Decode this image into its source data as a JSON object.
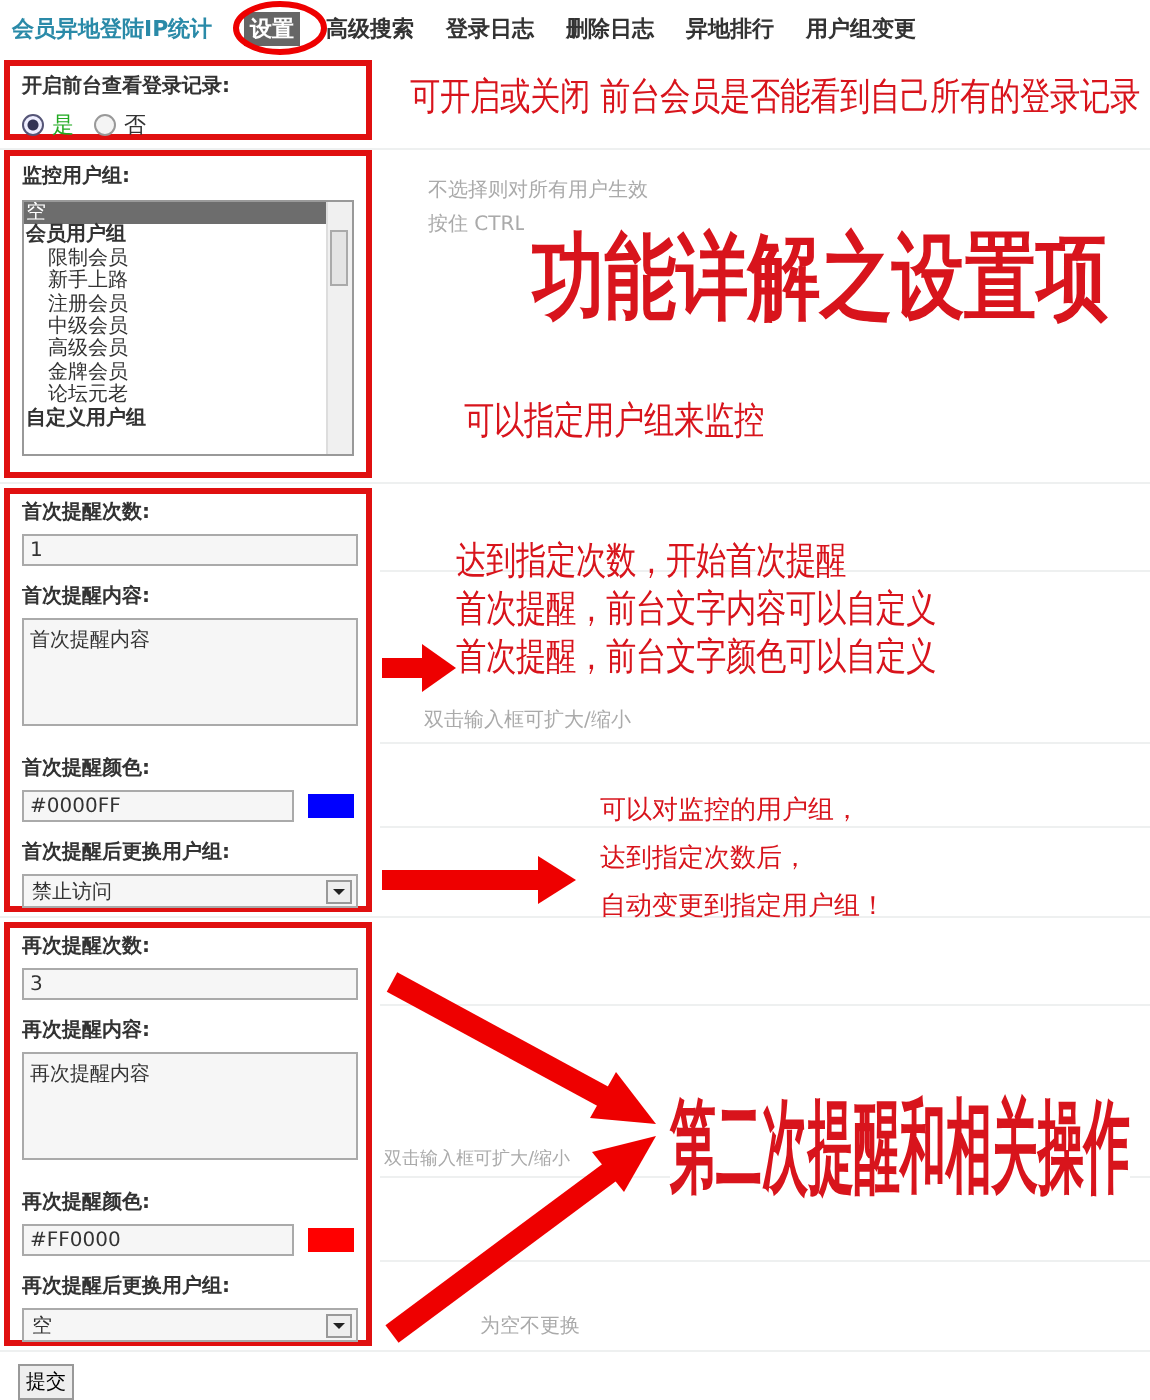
{
  "nav": {
    "title": "会员异地登陆IP统计",
    "tabs": [
      {
        "label": "设置",
        "selected": true
      },
      {
        "label": "高级搜索",
        "selected": false
      },
      {
        "label": "登录日志",
        "selected": false
      },
      {
        "label": "删除日志",
        "selected": false
      },
      {
        "label": "异地排行",
        "selected": false
      },
      {
        "label": "用户组变更",
        "selected": false
      }
    ]
  },
  "frontend_view": {
    "label": "开启前台查看登录记录:",
    "options": [
      {
        "label": "是",
        "selected": true
      },
      {
        "label": "否",
        "selected": false
      }
    ]
  },
  "monitor_groups": {
    "label": "监控用户组:",
    "hints": [
      "不选择则对所有用户生效",
      "按住 CTRL"
    ],
    "options": [
      {
        "label": "空",
        "selected": true
      },
      {
        "label": "会员用户组",
        "selected": false,
        "children": [
          {
            "label": "限制会员",
            "selected": false
          },
          {
            "label": "新手上路",
            "selected": false
          },
          {
            "label": "注册会员",
            "selected": false
          },
          {
            "label": "中级会员",
            "selected": false
          },
          {
            "label": "高级会员",
            "selected": false
          },
          {
            "label": "金牌会员",
            "selected": false
          },
          {
            "label": "论坛元老",
            "selected": false
          }
        ]
      },
      {
        "label": "自定义用户组",
        "selected": false
      }
    ]
  },
  "reminders": [
    {
      "count_label": "首次提醒次数:",
      "count": "1",
      "content_label": "首次提醒内容:",
      "content": "首次提醒内容",
      "content_hint": "双击输入框可扩大/缩小",
      "color_label": "首次提醒颜色:",
      "color_value": "#0000FF",
      "color": "#0000ff",
      "group_label": "首次提醒后更换用户组:",
      "group_value": "禁止访问"
    },
    {
      "count_label": "再次提醒次数:",
      "count": "3",
      "content_label": "再次提醒内容:",
      "content": "再次提醒内容",
      "content_hint": "双击输入框可扩大/缩小",
      "color_label": "再次提醒颜色:",
      "color_value": "#FF0000",
      "color": "#ff0000",
      "group_label": "再次提醒后更换用户组:",
      "group_value": "空",
      "group_hint": "为空不更换"
    }
  ],
  "submit": "提交",
  "annotations": [
    {
      "kind": "note",
      "lines": [
        "可开启或关闭 前台会员是否能看到自己所有的登录记录"
      ]
    },
    {
      "kind": "headline",
      "lines": [
        "功能详解之设置项"
      ]
    },
    {
      "kind": "note",
      "lines": [
        "可以指定用户组来监控"
      ]
    },
    {
      "kind": "note",
      "lines": [
        "达到指定次数，开始首次提醒",
        "首次提醒，前台文字内容可以自定义",
        "首次提醒，前台文字颜色可以自定义"
      ]
    },
    {
      "kind": "small",
      "lines": [
        "可以对监控的用户组，",
        "达到指定次数后，",
        "自动变更到指定用户组！"
      ]
    },
    {
      "kind": "banner",
      "lines": [
        "第二次提醒和相关操作"
      ]
    }
  ]
}
